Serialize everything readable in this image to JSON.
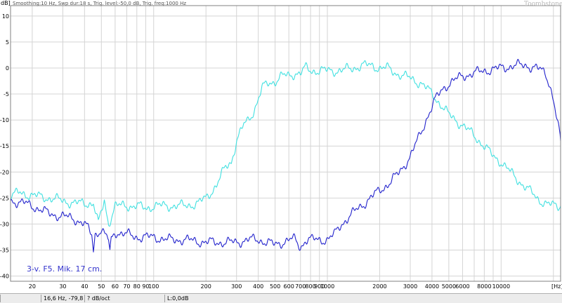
{
  "chart_data": {
    "type": "line",
    "info_line": "Smoothing:10 Hz, Swp dur:18 s, Trig. level:-50,0 dB, Trig. freq:1000 Hz",
    "brand": "Toombstone",
    "ylabel": "dB]",
    "xunit": "[Hz]",
    "annotation": "3-v. F5. Mik. 17 cm.",
    "x_scale": "log",
    "xlim": [
      15,
      22000
    ],
    "ylim": [
      -41,
      12
    ],
    "grid": true,
    "y_ticks": [
      10,
      5,
      0,
      -5,
      -10,
      -15,
      -20,
      -25,
      -30,
      -35,
      -40
    ],
    "y_tick_labels": [
      "10",
      "5",
      "0",
      "-5",
      "-10",
      "-15",
      "-20",
      "-25",
      "-30",
      "-35",
      "-40"
    ],
    "x_ticks": [
      20,
      30,
      40,
      50,
      60,
      70,
      80,
      90,
      100,
      200,
      300,
      400,
      500,
      600,
      700,
      800,
      900,
      1000,
      2000,
      3000,
      4000,
      5000,
      6000,
      8000,
      10000
    ],
    "x_tick_labels": [
      "20",
      "30",
      "40",
      "50",
      "60",
      "70",
      "80",
      "90",
      "100",
      "200",
      "300",
      "400",
      "500",
      "600",
      "700",
      "800",
      "900",
      "1000",
      "2000",
      "3000",
      "4000",
      "5000",
      "6000",
      "8000",
      "10000"
    ],
    "series": [
      {
        "color": "#40e0e0",
        "points": [
          [
            15,
            -24.5
          ],
          [
            17,
            -24
          ],
          [
            20,
            -24.5
          ],
          [
            25,
            -25
          ],
          [
            30,
            -25.5
          ],
          [
            35,
            -26
          ],
          [
            40,
            -26
          ],
          [
            45,
            -26
          ],
          [
            48,
            -30
          ],
          [
            52,
            -25.5
          ],
          [
            55,
            -30
          ],
          [
            60,
            -26.5
          ],
          [
            70,
            -26.5
          ],
          [
            80,
            -26.5
          ],
          [
            90,
            -27
          ],
          [
            100,
            -26.5
          ],
          [
            120,
            -26.5
          ],
          [
            150,
            -26.5
          ],
          [
            180,
            -26
          ],
          [
            200,
            -25
          ],
          [
            230,
            -22.5
          ],
          [
            260,
            -19
          ],
          [
            280,
            -18
          ],
          [
            300,
            -14
          ],
          [
            330,
            -11
          ],
          [
            350,
            -10
          ],
          [
            380,
            -8
          ],
          [
            400,
            -6
          ],
          [
            420,
            -4
          ],
          [
            450,
            -3
          ],
          [
            500,
            -2.5
          ],
          [
            550,
            -1.5
          ],
          [
            600,
            -1.5
          ],
          [
            650,
            -1
          ],
          [
            700,
            -1
          ],
          [
            750,
            0
          ],
          [
            800,
            -0.5
          ],
          [
            900,
            -0.5
          ],
          [
            1000,
            -0.5
          ],
          [
            1200,
            -0.5
          ],
          [
            1400,
            0
          ],
          [
            1600,
            0.5
          ],
          [
            1800,
            0.5
          ],
          [
            2000,
            0
          ],
          [
            2200,
            0
          ],
          [
            2500,
            -1
          ],
          [
            3000,
            -2
          ],
          [
            3500,
            -3
          ],
          [
            4000,
            -5
          ],
          [
            4500,
            -7
          ],
          [
            5000,
            -9
          ],
          [
            6000,
            -11
          ],
          [
            7000,
            -13
          ],
          [
            8000,
            -15
          ],
          [
            9000,
            -17
          ],
          [
            10000,
            -18
          ],
          [
            12000,
            -21
          ],
          [
            14000,
            -23
          ],
          [
            16000,
            -25
          ],
          [
            18000,
            -26
          ],
          [
            20000,
            -26.5
          ],
          [
            22000,
            -26.5
          ]
        ]
      },
      {
        "color": "#2222cc",
        "points": [
          [
            15,
            -25.5
          ],
          [
            18,
            -26
          ],
          [
            20,
            -26.5
          ],
          [
            25,
            -28
          ],
          [
            30,
            -28.5
          ],
          [
            35,
            -29
          ],
          [
            40,
            -30
          ],
          [
            44,
            -32
          ],
          [
            45,
            -35
          ],
          [
            46,
            -32
          ],
          [
            50,
            -31
          ],
          [
            52,
            -32
          ],
          [
            55,
            -33
          ],
          [
            56,
            -35.5
          ],
          [
            57,
            -33
          ],
          [
            60,
            -31.5
          ],
          [
            70,
            -32
          ],
          [
            80,
            -32.5
          ],
          [
            100,
            -32.5
          ],
          [
            120,
            -33
          ],
          [
            150,
            -33
          ],
          [
            200,
            -33.5
          ],
          [
            250,
            -33.5
          ],
          [
            300,
            -33.5
          ],
          [
            350,
            -33
          ],
          [
            400,
            -33
          ],
          [
            450,
            -33.5
          ],
          [
            500,
            -34
          ],
          [
            550,
            -33.5
          ],
          [
            600,
            -33
          ],
          [
            650,
            -33
          ],
          [
            700,
            -34.5
          ],
          [
            750,
            -33
          ],
          [
            800,
            -33
          ],
          [
            900,
            -33
          ],
          [
            1000,
            -33
          ],
          [
            1100,
            -32
          ],
          [
            1200,
            -30
          ],
          [
            1300,
            -29
          ],
          [
            1500,
            -27
          ],
          [
            1700,
            -25.5
          ],
          [
            2000,
            -23.5
          ],
          [
            2300,
            -22
          ],
          [
            2600,
            -20
          ],
          [
            3000,
            -17
          ],
          [
            3400,
            -13
          ],
          [
            3800,
            -9
          ],
          [
            4200,
            -6
          ],
          [
            4600,
            -4
          ],
          [
            5000,
            -3
          ],
          [
            6000,
            -1.5
          ],
          [
            7000,
            -1
          ],
          [
            8000,
            -0.5
          ],
          [
            10000,
            0
          ],
          [
            12000,
            0.5
          ],
          [
            14000,
            0.5
          ],
          [
            16000,
            0
          ],
          [
            18000,
            -1
          ],
          [
            19000,
            -3
          ],
          [
            20000,
            -6
          ],
          [
            21000,
            -10
          ],
          [
            22000,
            -14
          ]
        ]
      }
    ]
  },
  "status_bar": {
    "cursor": "16,6 Hz, -79,8 dB",
    "slope": "? dB/oct",
    "level": "L:0,0dB"
  }
}
